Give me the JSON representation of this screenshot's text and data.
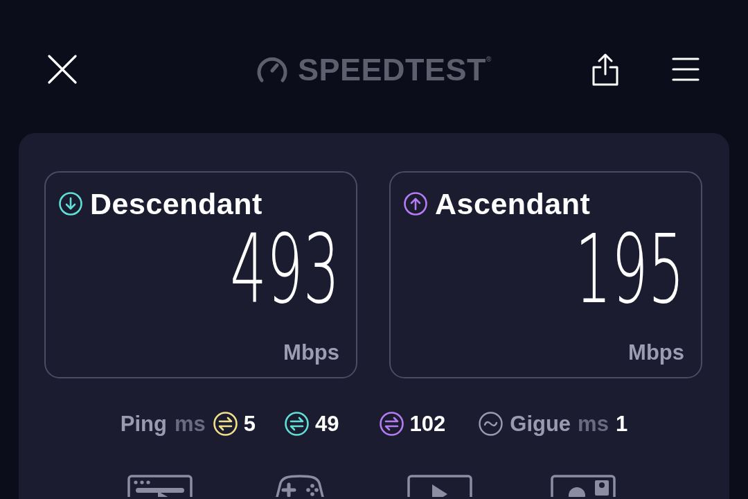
{
  "header": {
    "logo": "SPEEDTEST$^{®}$"
  },
  "results": [
    {
      "kind": "download",
      "label": "Descendant",
      "value": "493",
      "unit": "Mbps",
      "color": "#5fe0d6"
    },
    {
      "kind": "upload",
      "label": "Ascendant",
      "value": "195",
      "unit": "Mbps",
      "color": "#b47cf0"
    }
  ],
  "ping": {
    "label": "Ping",
    "unit": "ms",
    "readings": [
      {
        "value": "5",
        "color": "#f0e08a"
      },
      {
        "value": "49",
        "color": "#5fe0d6"
      },
      {
        "value": "102",
        "color": "#b47cf0"
      }
    ]
  },
  "jitter": {
    "label": "Gigue",
    "unit": "ms",
    "value": "1"
  },
  "test_types": [
    {
      "kind": "browsing"
    },
    {
      "kind": "gaming"
    },
    {
      "kind": "video"
    },
    {
      "kind": "video_call"
    }
  ]
}
